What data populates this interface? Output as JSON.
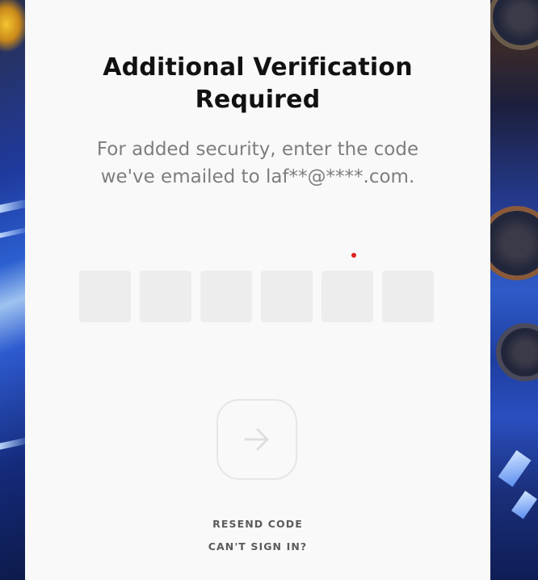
{
  "heading": {
    "title": "Additional Verification Required",
    "subtitle": "For added security, enter the code we've emailed to laf**@****.com."
  },
  "code_inputs": [
    {
      "value": "",
      "placeholder": ""
    },
    {
      "value": "",
      "placeholder": ""
    },
    {
      "value": "",
      "placeholder": ""
    },
    {
      "value": "",
      "placeholder": ""
    },
    {
      "value": "",
      "placeholder": ""
    },
    {
      "value": "",
      "placeholder": ""
    }
  ],
  "submit": {
    "icon": "arrow-right-icon",
    "enabled": false
  },
  "links": {
    "resend_code": "RESEND CODE",
    "cant_sign_in": "CAN'T SIGN IN?"
  },
  "colors": {
    "panel_background": "#f9f9f9",
    "title": "#111111",
    "subtitle": "#7e7e7e",
    "input_background": "#ededed",
    "button_border": "#e6e6e6",
    "arrow_disabled": "#dedede",
    "link": "#5b5b5b",
    "indicator_dot": "#e02020"
  }
}
